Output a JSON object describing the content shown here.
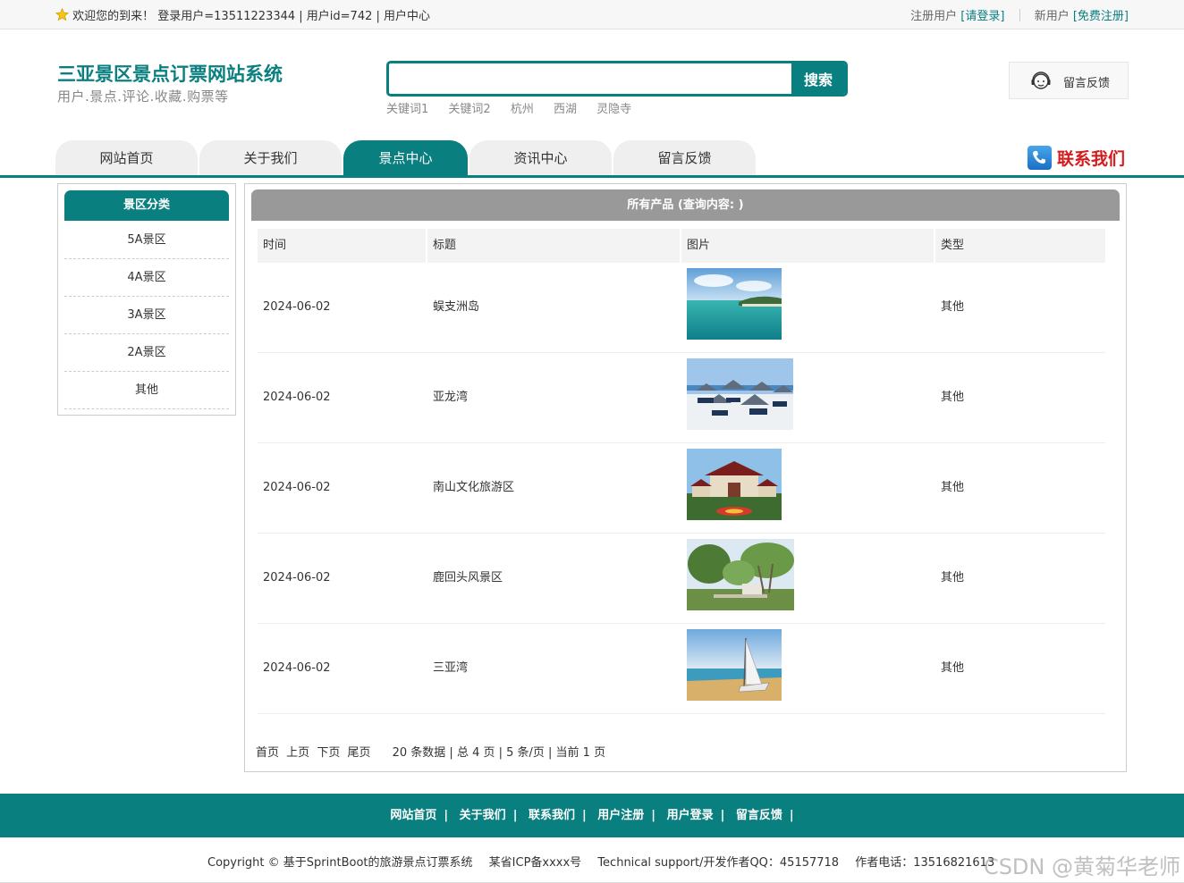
{
  "topbar": {
    "welcome": "欢迎您的到来！ 登录用户=13511223344 | 用户id=742 | 用户中心",
    "register_prompt": "注册用户",
    "login_link": "[请登录]",
    "new_user_prompt": "新用户",
    "register_link": "[免费注册]"
  },
  "header": {
    "title": "三亚景区景点订票网站系统",
    "subtitle": "用户.景点.评论.收藏.购票等",
    "search_placeholder": "",
    "search_button": "搜索",
    "keywords": [
      "关键词1",
      "关键词2",
      "杭州",
      "西湖",
      "灵隐寺"
    ],
    "feedback_label": "留言反馈"
  },
  "nav": {
    "tabs": [
      {
        "label": "网站首页"
      },
      {
        "label": "关于我们"
      },
      {
        "label": "景点中心"
      },
      {
        "label": "资讯中心"
      },
      {
        "label": "留言反馈"
      }
    ],
    "active_tab": "景点中心",
    "contact_label": "联系我们"
  },
  "sidebar": {
    "title": "景区分类",
    "items": [
      "5A景区",
      "4A景区",
      "3A景区",
      "2A景区",
      "其他"
    ]
  },
  "main": {
    "title": "所有产品 (查询内容: )",
    "columns": [
      "时间",
      "标题",
      "图片",
      "类型"
    ],
    "rows": [
      {
        "date": "2024-06-02",
        "title": "蜈支洲岛",
        "type": "其他",
        "image": "island-beach-photo"
      },
      {
        "date": "2024-06-02",
        "title": "亚龙湾",
        "type": "其他",
        "image": "beach-umbrellas-photo"
      },
      {
        "date": "2024-06-02",
        "title": "南山文化旅游区",
        "type": "其他",
        "image": "temple-gate-photo"
      },
      {
        "date": "2024-06-02",
        "title": "鹿回头风景区",
        "type": "其他",
        "image": "trees-park-photo"
      },
      {
        "date": "2024-06-02",
        "title": "三亚湾",
        "type": "其他",
        "image": "sailboat-beach-photo"
      }
    ],
    "pager": {
      "first": "首页",
      "prev": "上页",
      "next": "下页",
      "last": "尾页",
      "summary": "20 条数据 | 总 4 页 | 5 条/页 | 当前 1 页"
    }
  },
  "footer": {
    "links": [
      "网站首页",
      "关于我们",
      "联系我们",
      "用户注册",
      "用户登录",
      "留言反馈"
    ],
    "copyright": "Copyright © 基于SprintBoot的旅游景点订票系统",
    "icp": "某省ICP备xxxx号",
    "support": "Technical support/开发作者QQ：45157718",
    "phone": "作者电话：13516821613",
    "watermark": "CSDN @黄菊华老师"
  },
  "colors": {
    "brand": "#0a7f80",
    "contact_red": "#d51c1c",
    "header_gray": "#999999"
  }
}
